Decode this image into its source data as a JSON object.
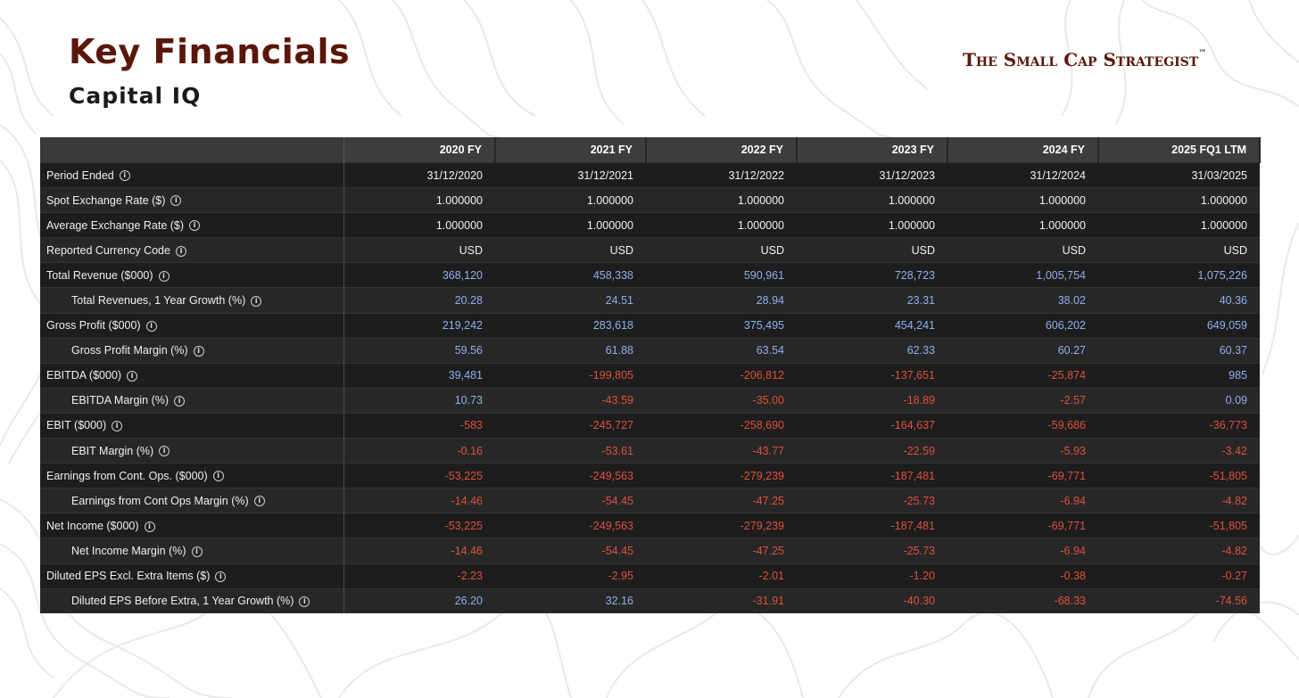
{
  "header": {
    "title": "Key Financials",
    "subtitle": "Capital IQ",
    "brand": "The Small Cap Strategist",
    "brand_mark": "™"
  },
  "colors": {
    "title": "#5a1709",
    "positive_value": "#8fb0ee",
    "negative_value": "#e0503c",
    "table_bg": "#1e1e1e",
    "header_bg": "#3d3d3d"
  },
  "table": {
    "columns": [
      "2020 FY",
      "2021 FY",
      "2022 FY",
      "2023 FY",
      "2024 FY",
      "2025 FQ1 LTM"
    ],
    "info_icon": "info-circle-icon",
    "rows": [
      {
        "label": "Period Ended",
        "indent": false,
        "tone": "plain",
        "values": [
          "31/12/2020",
          "31/12/2021",
          "31/12/2022",
          "31/12/2023",
          "31/12/2024",
          "31/03/2025"
        ]
      },
      {
        "label": "Spot Exchange Rate ($)",
        "indent": false,
        "tone": "plain",
        "values": [
          "1.000000",
          "1.000000",
          "1.000000",
          "1.000000",
          "1.000000",
          "1.000000"
        ]
      },
      {
        "label": "Average Exchange Rate ($)",
        "indent": false,
        "tone": "plain",
        "values": [
          "1.000000",
          "1.000000",
          "1.000000",
          "1.000000",
          "1.000000",
          "1.000000"
        ]
      },
      {
        "label": "Reported Currency Code",
        "indent": false,
        "tone": "plain",
        "values": [
          "USD",
          "USD",
          "USD",
          "USD",
          "USD",
          "USD"
        ]
      },
      {
        "label": "Total Revenue ($000)",
        "indent": false,
        "tone": "num",
        "values": [
          "368,120",
          "458,338",
          "590,961",
          "728,723",
          "1,005,754",
          "1,075,226"
        ]
      },
      {
        "label": "Total Revenues, 1 Year Growth (%)",
        "indent": true,
        "tone": "num",
        "values": [
          "20.28",
          "24.51",
          "28.94",
          "23.31",
          "38.02",
          "40.36"
        ]
      },
      {
        "label": "Gross Profit ($000)",
        "indent": false,
        "tone": "num",
        "values": [
          "219,242",
          "283,618",
          "375,495",
          "454,241",
          "606,202",
          "649,059"
        ]
      },
      {
        "label": "Gross Profit Margin (%)",
        "indent": true,
        "tone": "num",
        "values": [
          "59.56",
          "61.88",
          "63.54",
          "62.33",
          "60.27",
          "60.37"
        ]
      },
      {
        "label": "EBITDA ($000)",
        "indent": false,
        "tone": "num",
        "values": [
          "39,481",
          "-199,805",
          "-206,812",
          "-137,651",
          "-25,874",
          "985"
        ]
      },
      {
        "label": "EBITDA Margin (%)",
        "indent": true,
        "tone": "num",
        "values": [
          "10.73",
          "-43.59",
          "-35.00",
          "-18.89",
          "-2.57",
          "0.09"
        ]
      },
      {
        "label": "EBIT ($000)",
        "indent": false,
        "tone": "num",
        "values": [
          "-583",
          "-245,727",
          "-258,690",
          "-164,637",
          "-59,686",
          "-36,773"
        ]
      },
      {
        "label": "EBIT Margin (%)",
        "indent": true,
        "tone": "num",
        "values": [
          "-0.16",
          "-53.61",
          "-43.77",
          "-22.59",
          "-5.93",
          "-3.42"
        ]
      },
      {
        "label": "Earnings from Cont. Ops. ($000)",
        "indent": false,
        "tone": "num",
        "values": [
          "-53,225",
          "-249,563",
          "-279,239",
          "-187,481",
          "-69,771",
          "-51,805"
        ]
      },
      {
        "label": "Earnings from Cont Ops Margin (%)",
        "indent": true,
        "tone": "num",
        "values": [
          "-14.46",
          "-54.45",
          "-47.25",
          "-25.73",
          "-6.94",
          "-4.82"
        ]
      },
      {
        "label": "Net Income ($000)",
        "indent": false,
        "tone": "num",
        "values": [
          "-53,225",
          "-249,563",
          "-279,239",
          "-187,481",
          "-69,771",
          "-51,805"
        ]
      },
      {
        "label": "Net Income Margin (%)",
        "indent": true,
        "tone": "num",
        "values": [
          "-14.46",
          "-54.45",
          "-47.25",
          "-25.73",
          "-6.94",
          "-4.82"
        ]
      },
      {
        "label": "Diluted EPS Excl. Extra Items ($)",
        "indent": false,
        "tone": "num",
        "values": [
          "-2.23",
          "-2.95",
          "-2.01",
          "-1.20",
          "-0.38",
          "-0.27"
        ]
      },
      {
        "label": "Diluted EPS Before Extra, 1 Year Growth (%)",
        "indent": true,
        "tone": "num",
        "values": [
          "26.20",
          "32.16",
          "-31.91",
          "-40.30",
          "-68.33",
          "-74.56"
        ]
      }
    ]
  }
}
